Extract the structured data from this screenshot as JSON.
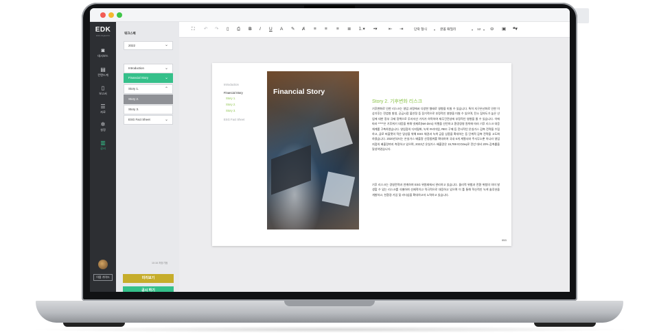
{
  "sidebar": {
    "logo": "EDK",
    "logo_sub": "ESG Digital Kit",
    "items": [
      {
        "label": "대시보드",
        "icon": "camera-icon"
      },
      {
        "label": "컨텐드계",
        "icon": "calendar-icon"
      },
      {
        "label": "보고서",
        "icon": "document-icon"
      },
      {
        "label": "자료",
        "icon": "list-icon"
      },
      {
        "label": "설정",
        "icon": "gear-icon"
      },
      {
        "label": "공시",
        "icon": "book-icon",
        "active": true
      }
    ],
    "user_guide": "이용 가이드"
  },
  "panel": {
    "title": "워크스페",
    "year": "2022",
    "nav": [
      "Introduction",
      "Financial Story",
      "Story 1.",
      "Story 2.",
      "Story 3.",
      "ESG Fact Sheet"
    ],
    "saved": "10:16 저장기점",
    "preview_button": "미리보기",
    "publish_button": "공시 하기",
    "edit_button": "수정"
  },
  "toolbar": {
    "paragraph_format": "단락 형식",
    "font_family": "글꼴 패밀리",
    "font_size": "12"
  },
  "document": {
    "toc": [
      "Introduction",
      "Financial Story",
      "Story 1.",
      "Story 2.",
      "Story 3.",
      "ESG Fact Sheet"
    ],
    "hero_title": "Financial Story",
    "story_title": "Story 2. 기후변화 리스크",
    "paragraph1": "기후변화로 인한 리스크는 영업 과정에서 다양한 형태로 영향을 미칠 수 있습니다. 특히 지구온난화로 인한 이상기후는 전염병 발생, 공급시장 불안정 등 장기적으로 부정적인 영향을 미칠 수 있으며, 탄소 집약도가 높은 산업에 대한 정부 규제 정책으로 투자자산 가치가 하락하여 재무건전성에 부정적인 영향을 줄 수 있습니다. 이에 따라 *****은 기후위기 대응을 위해 넷제로(Net-Zero) 이행을 선언하고 환경경영 원칙에 따라 기후 리스크 대응체계를 구축하였습니다. 영업점의 디지털화, 녹색 프리미엄, REC 구매 등 전사적인 온실가스 감축 전략을 수립하고, 글로 퍼플렛의 적은 달성을 위해 ESG 채권과 녹색 금융 상품을 확대하는 등 단계적 감축 전략을 고도화하였습니다. 2020년부터는 온실가스 배출량 산정범위를 확대하여 국내 6개 계열사와 주사무소뿐 아니라 영업지점의 배출량까지 측정하고 있으며, 2021년 온실가스 배출량은 15,789 tCO2eq로 전년 대비 20% 감축률을 달성하였습니다.",
    "paragraph2": "기후 리스크는 경영전략과 연계하여 ESG 위원회에서 관리하고 있습니다. 물리적 위험과 전환 위험의 의미 발생할 수 있는 리스크를 식별하여 선제적이고 적극적으로 대응하고 있으며 이 틀 통해 혁신적인 녹색 솔루션을 개발하고, 친환경 기업 및 리더십을 확대하고자 노력하고 있습니다.",
    "page_number": "053"
  },
  "colors": {
    "accent_green": "#35c08a",
    "story_green": "#8bc34a",
    "preview_gold": "#c6ad2b",
    "rail_dark": "#2d2f33"
  }
}
